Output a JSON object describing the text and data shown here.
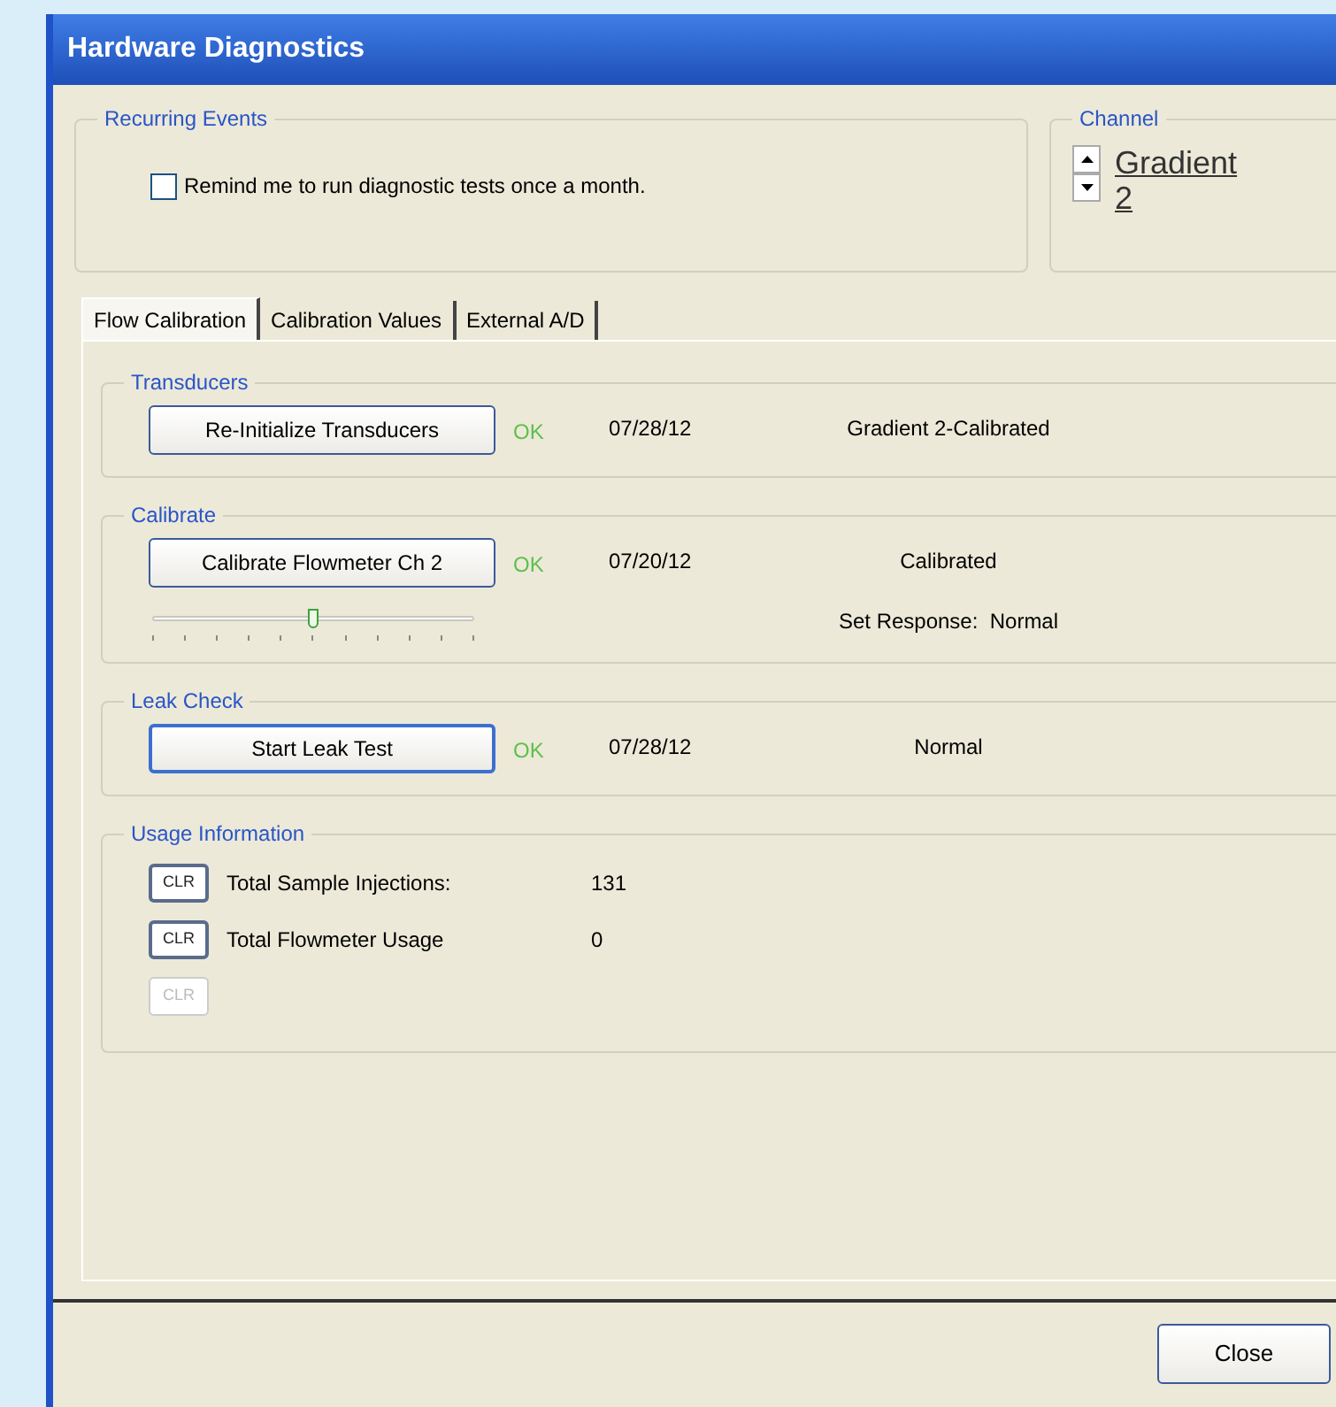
{
  "window": {
    "title": "Hardware Diagnostics"
  },
  "recurring_events": {
    "legend": "Recurring Events",
    "checkbox": {
      "label": "Remind me to run diagnostic tests once a month.",
      "checked": false
    }
  },
  "channel": {
    "legend": "Channel",
    "value": "Gradient 2"
  },
  "tabs": [
    {
      "label": "Flow Calibration",
      "selected": true
    },
    {
      "label": "Calibration Values",
      "selected": false
    },
    {
      "label": "External A/D",
      "selected": false
    }
  ],
  "sections": [
    {
      "legend": "Transducers",
      "button": "Re-Initialize Transducers",
      "button_focused": false,
      "status": "OK",
      "date": "07/28/12",
      "result": "Gradient 2-Calibrated"
    },
    {
      "legend": "Calibrate",
      "button": "Calibrate Flowmeter Ch 2",
      "button_focused": false,
      "status": "OK",
      "date": "07/20/12",
      "result": "Calibrated",
      "slider": {
        "level": 0.5
      },
      "note": "Set Response:  Normal"
    },
    {
      "legend": "Leak Check",
      "button": "Start Leak Test",
      "button_focused": true,
      "status": "OK",
      "date": "07/28/12",
      "result": "Normal"
    }
  ],
  "usage": {
    "legend": "Usage Information",
    "rows": [
      {
        "button": "CLR",
        "disabled": false,
        "label": "Total Sample Injections:",
        "value": "131"
      },
      {
        "button": "CLR",
        "disabled": false,
        "label": "Total Flowmeter Usage",
        "value": "0"
      },
      {
        "button": "CLR",
        "disabled": true
      }
    ]
  },
  "footer": {
    "close": "Close"
  }
}
